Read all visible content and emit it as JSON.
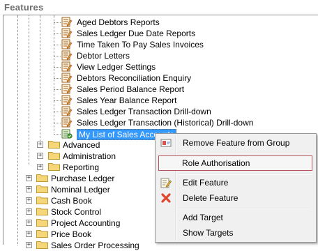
{
  "header": {
    "title": "Features"
  },
  "tree": {
    "reports": [
      "Aged Debtors Reports",
      "Sales Ledger Due Date Reports",
      "Time Taken To Pay Sales Invoices",
      "Debtor Letters",
      "View Ledger Settings",
      "Debtors Reconciliation Enquiry",
      "Sales Period Balance Report",
      "Sales Year Balance Report",
      "Sales Ledger Transaction Drill-down",
      "Sales Ledger Transaction (Historical) Drill-down"
    ],
    "selected": "My List of Sales Accounts",
    "subfolders": [
      "Advanced",
      "Administration",
      "Reporting"
    ],
    "modules": [
      "Purchase Ledger",
      "Nominal Ledger",
      "Cash Book",
      "Stock Control",
      "Project Accounting",
      "Price Book",
      "Sales Order Processing"
    ],
    "expander_symbol": "+"
  },
  "context_menu": {
    "remove": "Remove Feature from Group",
    "role": "Role Authorisation",
    "edit": "Edit Feature",
    "delete": "Delete Feature",
    "add_target": "Add Target",
    "show_targets": "Show Targets"
  },
  "colors": {
    "selection": "#3399ff",
    "folder": "#f5d77a",
    "menu_highlight_border": "#b5545b",
    "delete_icon": "#e0452b"
  }
}
